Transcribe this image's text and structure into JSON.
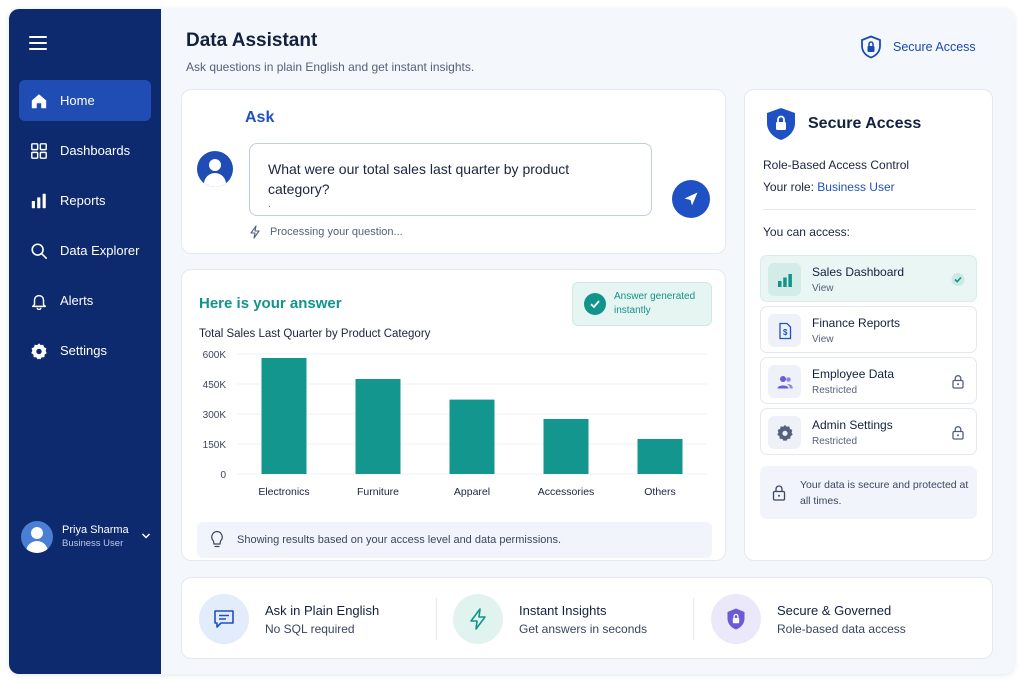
{
  "sidebar": {
    "items": [
      {
        "label": "Home",
        "icon": "home-icon"
      },
      {
        "label": "Dashboards",
        "icon": "dashboards-icon"
      },
      {
        "label": "Reports",
        "icon": "reports-icon"
      },
      {
        "label": "Data Explorer",
        "icon": "search-icon"
      },
      {
        "label": "Alerts",
        "icon": "bell-icon"
      },
      {
        "label": "Settings",
        "icon": "gear-icon"
      }
    ],
    "active_index": 0,
    "user": {
      "name": "Priya Sharma",
      "role": "Business User"
    }
  },
  "header": {
    "title": "Data Assistant",
    "subtitle": "Ask questions in plain English and get instant insights.",
    "secure_label": "Secure Access"
  },
  "ask": {
    "label": "Ask",
    "question": "What were our total sales last quarter by product category?",
    "cursor": ".",
    "status": "Processing your question..."
  },
  "answer": {
    "title": "Here is your answer",
    "badge": "Answer generated instantly",
    "info": "Showing results based on your access level and data permissions."
  },
  "chart_data": {
    "type": "bar",
    "title": "Total Sales Last Quarter by Product Category",
    "categories": [
      "Electronics",
      "Furniture",
      "Apparel",
      "Accessories",
      "Others"
    ],
    "values": [
      580000,
      475000,
      372000,
      275000,
      175000
    ],
    "ylim": [
      0,
      600000
    ],
    "yticks": [
      0,
      150000,
      300000,
      450000,
      600000
    ],
    "ytick_labels": [
      "0",
      "150K",
      "300K",
      "450K",
      "600K"
    ],
    "xlabel": "",
    "ylabel": "",
    "grid": true,
    "bar_color": "#13968d"
  },
  "secure": {
    "title": "Secure Access",
    "rbac": "Role-Based Access Control",
    "role_prefix": "Your role: ",
    "role": "Business User",
    "can_access": "You can access:",
    "items": [
      {
        "name": "Sales Dashboard",
        "level": "View",
        "status": "check",
        "icon": "bar-chart-icon"
      },
      {
        "name": "Finance Reports",
        "level": "View",
        "status": "none",
        "icon": "document-dollar-icon"
      },
      {
        "name": "Employee Data",
        "level": "Restricted",
        "status": "locked",
        "icon": "users-icon"
      },
      {
        "name": "Admin Settings",
        "level": "Restricted",
        "status": "locked",
        "icon": "gear-icon"
      }
    ],
    "note": "Your data is secure and protected at all times."
  },
  "features": [
    {
      "title": "Ask in Plain English",
      "subtitle": "No SQL required",
      "icon": "chat-icon"
    },
    {
      "title": "Instant Insights",
      "subtitle": "Get answers in seconds",
      "icon": "lightning-icon"
    },
    {
      "title": "Secure & Governed",
      "subtitle": "Role-based data access",
      "icon": "shield-lock-icon"
    }
  ],
  "colors": {
    "sidebar": "#0e2a6e",
    "active_nav": "#1f4db3",
    "accent": "#1f50c4",
    "teal": "#13968d"
  }
}
